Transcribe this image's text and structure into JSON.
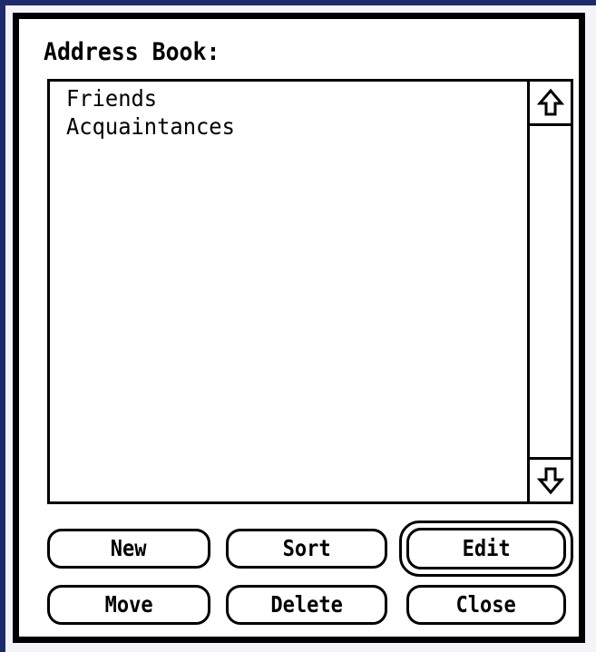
{
  "dialog": {
    "title": "Address Book:"
  },
  "list": {
    "items": [
      {
        "label": "Friends"
      },
      {
        "label": "Acquaintances"
      }
    ]
  },
  "scrollbar": {
    "up_icon": "up-arrow-icon",
    "down_icon": "down-arrow-icon"
  },
  "buttons": {
    "new_label": "New",
    "sort_label": "Sort",
    "edit_label": "Edit",
    "move_label": "Move",
    "delete_label": "Delete",
    "close_label": "Close",
    "default_button": "Edit"
  },
  "colors": {
    "frame": "#000000",
    "background": "#ffffff",
    "desktop_edge": "#1d2a6e"
  }
}
